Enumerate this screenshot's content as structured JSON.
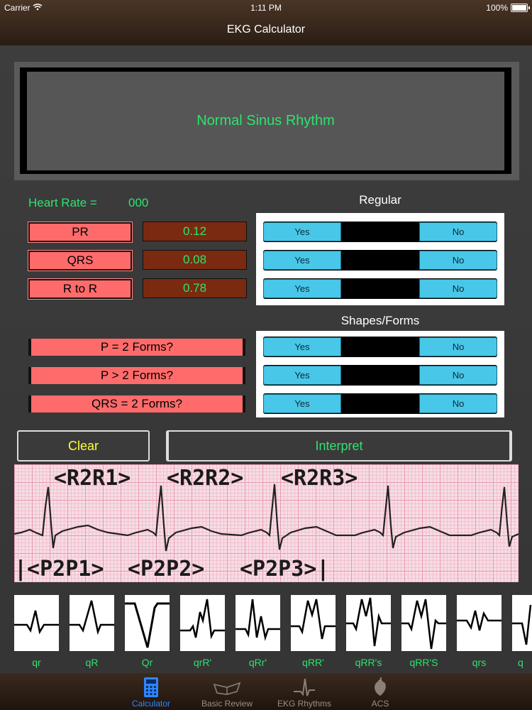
{
  "status": {
    "carrier": "Carrier",
    "time": "1:11 PM",
    "battery": "100%"
  },
  "nav": {
    "title": "EKG Calculator"
  },
  "result": {
    "text": "Normal Sinus Rhythm"
  },
  "heart_rate": {
    "label": "Heart Rate =",
    "value": "000"
  },
  "sections": {
    "regular": "Regular",
    "shapes": "Shapes/Forms"
  },
  "measures": [
    {
      "label": "PR",
      "value": "0.12"
    },
    {
      "label": "QRS",
      "value": "0.08"
    },
    {
      "label": "R to R",
      "value": "0.78"
    }
  ],
  "forms": [
    {
      "label": "P = 2 Forms?"
    },
    {
      "label": "P > 2 Forms?"
    },
    {
      "label": "QRS = 2 Forms?"
    }
  ],
  "segment": {
    "yes": "Yes",
    "no": "No"
  },
  "buttons": {
    "clear": "Clear",
    "interpret": "Interpret"
  },
  "ekg": {
    "top_labels": [
      "<R2R1>",
      "<R2R2>",
      "<R2R3>"
    ],
    "bottom_labels": [
      "|<P2P1>",
      "<P2P2>",
      "<P2P3>|"
    ]
  },
  "complexes": [
    "qr",
    "qR",
    "Qr",
    "qrR'",
    "qRr'",
    "qRR'",
    "qRR's",
    "qRR'S",
    "qrs",
    "q"
  ],
  "tabs": [
    {
      "label": "Calculator",
      "icon": "calculator-icon",
      "active": true
    },
    {
      "label": "Basic Review",
      "icon": "book-icon",
      "active": false
    },
    {
      "label": "EKG Rhythms",
      "icon": "ekg-wave-icon",
      "active": false
    },
    {
      "label": "ACS",
      "icon": "heart-icon",
      "active": false
    }
  ],
  "colors": {
    "accent_green": "#2ee36f",
    "pink": "#ff6b6b",
    "cyan": "#49c7e8",
    "value_brown": "#7a2a10",
    "tab_active": "#2f86ff",
    "clear_yellow": "#ffff3a"
  }
}
